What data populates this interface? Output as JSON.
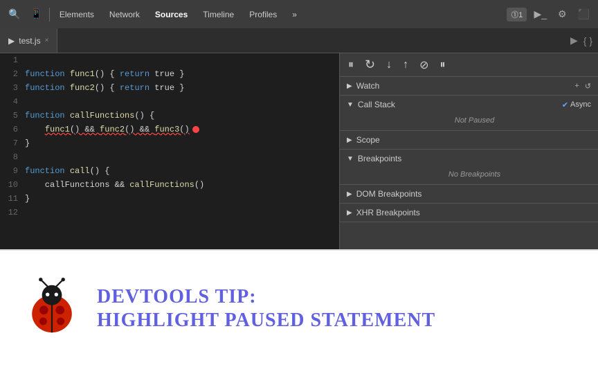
{
  "toolbar": {
    "tabs": [
      {
        "label": "Elements",
        "active": false
      },
      {
        "label": "Network",
        "active": false
      },
      {
        "label": "Sources",
        "active": true
      },
      {
        "label": "Timeline",
        "active": false
      },
      {
        "label": "Profiles",
        "active": false
      }
    ],
    "badge": "⓵1",
    "more_tabs": "»"
  },
  "file_tab": {
    "filename": "test.js",
    "close": "×"
  },
  "debug_toolbar": {
    "pause": "⏸",
    "refresh": "↺",
    "step_over": "↓",
    "step_into": "↑",
    "deactivate": "⊘",
    "resume": "⏸"
  },
  "code_lines": [
    {
      "num": "1",
      "content": ""
    },
    {
      "num": "2",
      "content": "function func1() { return true }"
    },
    {
      "num": "3",
      "content": "function func2() { return true }"
    },
    {
      "num": "4",
      "content": ""
    },
    {
      "num": "5",
      "content": "function callFunctions() {"
    },
    {
      "num": "6",
      "content": "    func1() && func2() && func3()"
    },
    {
      "num": "7",
      "content": "}"
    },
    {
      "num": "8",
      "content": ""
    },
    {
      "num": "9",
      "content": "function call() {"
    },
    {
      "num": "10",
      "content": "    callFunctions && callFunctions()"
    },
    {
      "num": "11",
      "content": "}"
    },
    {
      "num": "12",
      "content": ""
    }
  ],
  "debugger": {
    "watch": {
      "label": "Watch",
      "expanded": true,
      "add_btn": "+",
      "refresh_btn": "↺"
    },
    "call_stack": {
      "label": "Call Stack",
      "expanded": true,
      "async_label": "Async",
      "status": "Not Paused"
    },
    "scope": {
      "label": "Scope",
      "expanded": false
    },
    "breakpoints": {
      "label": "Breakpoints",
      "expanded": true,
      "status": "No Breakpoints"
    },
    "dom_breakpoints": {
      "label": "DOM Breakpoints",
      "expanded": false
    },
    "xhr_breakpoints": {
      "label": "XHR Breakpoints",
      "expanded": false
    }
  },
  "promo": {
    "title_line1": "DevTools Tip:",
    "title_line2": "Highlight Paused Statement"
  }
}
